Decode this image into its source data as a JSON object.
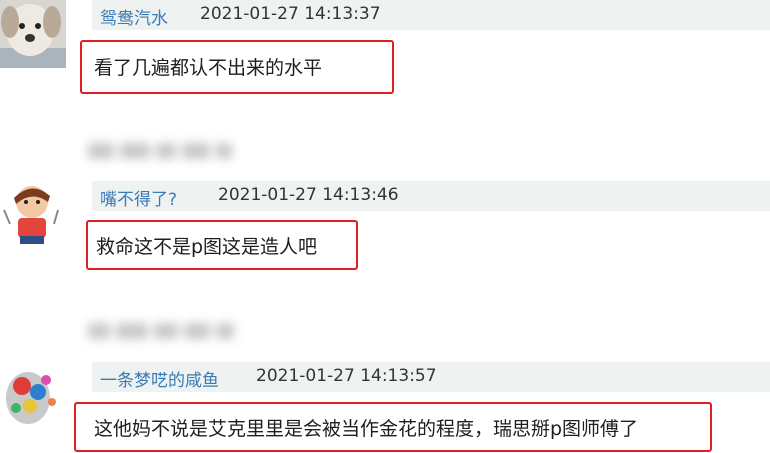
{
  "comments": [
    {
      "username": "鸳鸯汽水",
      "timestamp": "2021-01-27 14:13:37",
      "text": "看了几遍都认不出来的水平"
    },
    {
      "username": "嘴不得了?",
      "timestamp": "2021-01-27 14:13:46",
      "text": "救命这不是p图这是造人吧"
    },
    {
      "username": "一条梦呓的咸鱼",
      "timestamp": "2021-01-27 14:13:57",
      "text": "这他妈不说是艾克里里是会被当作金花的程度，瑞思掰p图师傅了"
    }
  ],
  "colors": {
    "username": "#3a7ab7",
    "header_background": "#eef3f1",
    "highlight_border": "#e02020"
  },
  "icons": [
    "avatar-dog",
    "avatar-cartoon-boy",
    "avatar-colorful-face"
  ]
}
